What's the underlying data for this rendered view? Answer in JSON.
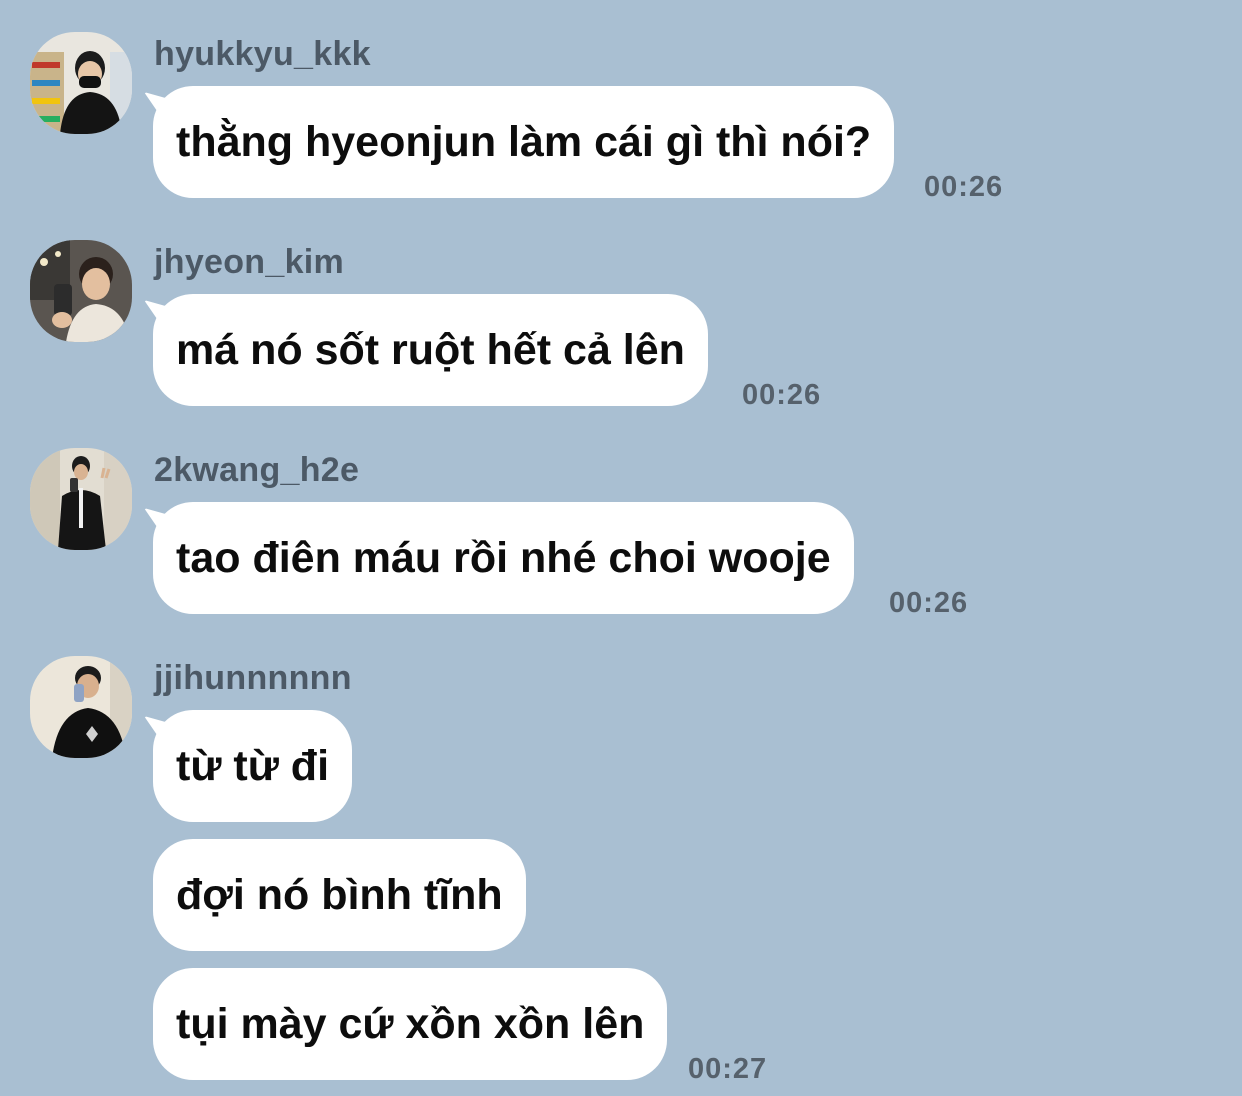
{
  "chat": {
    "messages": [
      {
        "sender": "hyukkyu_kkk",
        "bubbles": [
          "thằng hyeonjun làm cái gì thì nói?"
        ],
        "time": "00:26"
      },
      {
        "sender": "jhyeon_kim",
        "bubbles": [
          "má nó sốt ruột hết cả lên"
        ],
        "time": "00:26"
      },
      {
        "sender": "2kwang_h2e",
        "bubbles": [
          "tao điên máu rồi nhé choi wooje"
        ],
        "time": "00:26"
      },
      {
        "sender": "jjihunnnnnn",
        "bubbles": [
          "từ từ đi",
          "đợi nó bình tĩnh",
          "tụi mày cứ xồn xồn lên"
        ],
        "time": "00:27"
      }
    ]
  },
  "colors": {
    "background": "#a9bfd2",
    "bubble": "#ffffff",
    "sender_text": "#4c5966",
    "time_text": "#56616c"
  },
  "icons": [
    "avatar-hyukkyu_kkk",
    "avatar-jhyeon_kim",
    "avatar-2kwang_h2e",
    "avatar-jjihunnnnnn"
  ]
}
